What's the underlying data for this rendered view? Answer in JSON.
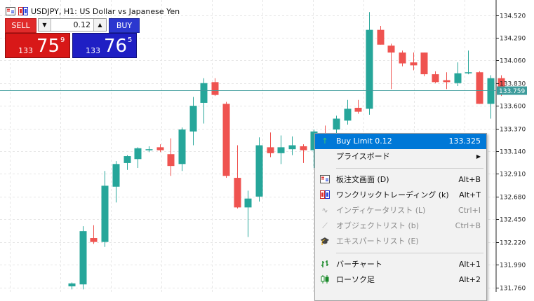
{
  "window": {
    "title": "USDJPY, H1:  US Dollar vs Japanese Yen"
  },
  "one_click_trading": {
    "sell_label": "SELL",
    "buy_label": "BUY",
    "lot_value": "0.12",
    "bid": {
      "prefix": "133",
      "big": "75",
      "sup": "9"
    },
    "ask": {
      "prefix": "133",
      "big": "76",
      "sup": "5"
    }
  },
  "price_axis": {
    "ticks": [
      "134.520",
      "134.290",
      "134.060",
      "133.830",
      "133.600",
      "133.370",
      "133.140",
      "132.910",
      "132.680",
      "132.450",
      "132.220",
      "131.990",
      "131.760"
    ],
    "current_price_label": "133.759"
  },
  "colors": {
    "bull": "#26a69a",
    "bear": "#ef5350",
    "highlight": "#0078d7",
    "price_line": "#3d9c9c"
  },
  "context_menu": {
    "items": [
      {
        "label": "Buy Limit 0.12",
        "shortcut": "133.325",
        "icon": "up-arrow-icon",
        "highlighted": true,
        "disabled": false
      },
      {
        "label": "プライスボード",
        "shortcut": "",
        "icon": "",
        "submenu": true,
        "disabled": false
      },
      {
        "separator": true
      },
      {
        "label": "板注文画面 (D)",
        "shortcut": "Alt+B",
        "icon": "depth-of-market-icon",
        "disabled": false
      },
      {
        "label": "ワンクリックトレーディング (k)",
        "shortcut": "Alt+T",
        "icon": "one-click-trading-icon",
        "disabled": false
      },
      {
        "label": "インディケータリスト (L)",
        "shortcut": "Ctrl+I",
        "icon": "indicators-icon",
        "disabled": true
      },
      {
        "label": "オブジェクトリスト (b)",
        "shortcut": "Ctrl+B",
        "icon": "objects-icon",
        "disabled": true
      },
      {
        "label": "エキスパートリスト (E)",
        "shortcut": "",
        "icon": "experts-icon",
        "disabled": true
      },
      {
        "separator": true
      },
      {
        "label": "バーチャート",
        "shortcut": "Alt+1",
        "icon": "bar-chart-icon",
        "disabled": false
      },
      {
        "label": "ローソク足",
        "shortcut": "Alt+2",
        "icon": "candlestick-icon",
        "disabled": false
      }
    ]
  },
  "chart_data": {
    "type": "candlestick",
    "symbol": "USDJPY",
    "timeframe": "H1",
    "ylim": [
      131.74,
      134.56
    ],
    "current_price": 133.759,
    "grid": true,
    "candles": [
      {
        "o": 131.77,
        "h": 131.81,
        "l": 131.74,
        "c": 131.8
      },
      {
        "o": 131.79,
        "h": 132.38,
        "l": 131.74,
        "c": 132.33
      },
      {
        "o": 132.26,
        "h": 132.39,
        "l": 132.2,
        "c": 132.22
      },
      {
        "o": 132.22,
        "h": 132.94,
        "l": 132.17,
        "c": 132.79
      },
      {
        "o": 132.78,
        "h": 133.04,
        "l": 132.62,
        "c": 133.01
      },
      {
        "o": 133.02,
        "h": 133.1,
        "l": 132.95,
        "c": 133.09
      },
      {
        "o": 133.06,
        "h": 133.18,
        "l": 132.97,
        "c": 133.17
      },
      {
        "o": 133.16,
        "h": 133.19,
        "l": 133.13,
        "c": 133.16
      },
      {
        "o": 133.18,
        "h": 133.21,
        "l": 133.13,
        "c": 133.15
      },
      {
        "o": 133.11,
        "h": 133.27,
        "l": 132.89,
        "c": 132.99
      },
      {
        "o": 133.01,
        "h": 133.38,
        "l": 132.94,
        "c": 133.36
      },
      {
        "o": 133.34,
        "h": 133.69,
        "l": 133.2,
        "c": 133.6
      },
      {
        "o": 133.63,
        "h": 133.88,
        "l": 133.42,
        "c": 133.83
      },
      {
        "o": 133.84,
        "h": 133.88,
        "l": 133.7,
        "c": 133.71
      },
      {
        "o": 133.62,
        "h": 133.64,
        "l": 132.87,
        "c": 132.89
      },
      {
        "o": 132.87,
        "h": 133.2,
        "l": 132.56,
        "c": 132.57
      },
      {
        "o": 132.57,
        "h": 132.74,
        "l": 132.27,
        "c": 132.66
      },
      {
        "o": 132.68,
        "h": 133.28,
        "l": 132.63,
        "c": 133.2
      },
      {
        "o": 133.18,
        "h": 133.33,
        "l": 133.08,
        "c": 133.12
      },
      {
        "o": 133.12,
        "h": 133.3,
        "l": 133.01,
        "c": 133.18
      },
      {
        "o": 133.16,
        "h": 133.29,
        "l": 133.1,
        "c": 133.2
      },
      {
        "o": 133.19,
        "h": 133.21,
        "l": 133.02,
        "c": 133.15
      },
      {
        "o": 133.15,
        "h": 133.36,
        "l": 132.97,
        "c": 133.34
      },
      {
        "o": 133.31,
        "h": 133.4,
        "l": 133.08,
        "c": 133.19
      },
      {
        "o": 133.36,
        "h": 133.5,
        "l": 133.3,
        "c": 133.47
      },
      {
        "o": 133.45,
        "h": 133.66,
        "l": 133.41,
        "c": 133.57
      },
      {
        "o": 133.58,
        "h": 133.66,
        "l": 133.52,
        "c": 133.54
      },
      {
        "o": 133.57,
        "h": 134.55,
        "l": 133.51,
        "c": 134.37
      },
      {
        "o": 134.37,
        "h": 134.41,
        "l": 134.22,
        "c": 134.22
      },
      {
        "o": 134.21,
        "h": 134.23,
        "l": 133.77,
        "c": 134.14
      },
      {
        "o": 134.14,
        "h": 134.16,
        "l": 134.0,
        "c": 134.03
      },
      {
        "o": 134.04,
        "h": 134.14,
        "l": 133.96,
        "c": 134.01
      },
      {
        "o": 134.14,
        "h": 134.14,
        "l": 133.9,
        "c": 133.92
      },
      {
        "o": 133.92,
        "h": 133.95,
        "l": 133.83,
        "c": 133.84
      },
      {
        "o": 133.86,
        "h": 133.94,
        "l": 133.77,
        "c": 133.84
      },
      {
        "o": 133.83,
        "h": 134.04,
        "l": 133.8,
        "c": 133.93
      },
      {
        "o": 133.94,
        "h": 134.16,
        "l": 133.92,
        "c": 133.94
      },
      {
        "o": 133.94,
        "h": 133.95,
        "l": 133.62,
        "c": 133.62
      },
      {
        "o": 133.62,
        "h": 133.91,
        "l": 133.47,
        "c": 133.88
      },
      {
        "o": 133.88,
        "h": 133.91,
        "l": 133.7,
        "c": 133.75
      }
    ]
  }
}
